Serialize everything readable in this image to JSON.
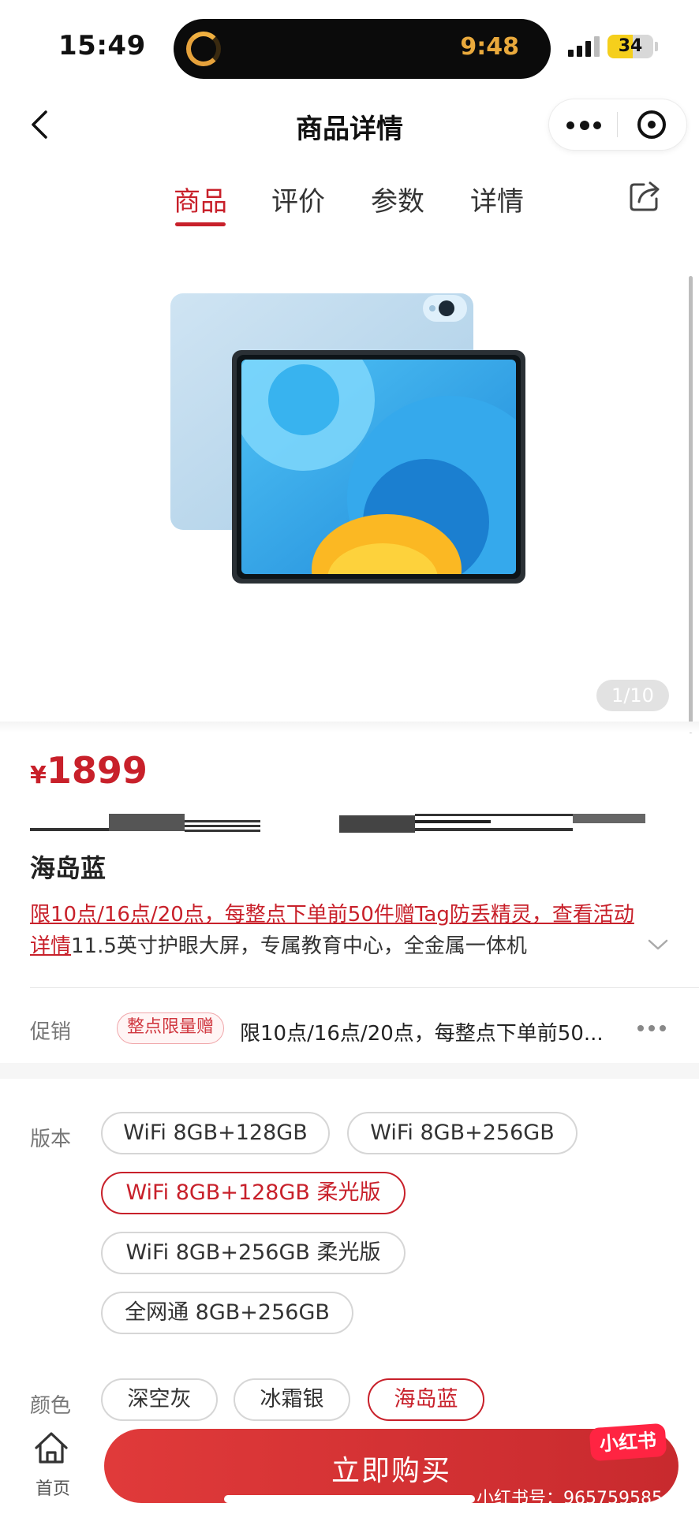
{
  "status_bar": {
    "time": "15:49",
    "island_time": "9:48",
    "battery": "34"
  },
  "nav": {
    "title": "商品详情"
  },
  "tabs": [
    {
      "label": "商品",
      "active": true
    },
    {
      "label": "评价",
      "active": false
    },
    {
      "label": "参数",
      "active": false
    },
    {
      "label": "详情",
      "active": false
    }
  ],
  "gallery": {
    "counter": "1/10"
  },
  "product": {
    "currency": "¥",
    "price": "1899",
    "color_name": "海岛蓝",
    "desc_highlight": "限10点/16点/20点，每整点下单前50件赠Tag防丢精灵，查看活动详情",
    "desc_rest": "11.5英寸护眼大屏，专属教育中心，全金属一体机"
  },
  "promo": {
    "label": "促销",
    "tag": "整点限量赠",
    "text": "限10点/16点/20点，每整点下单前50..."
  },
  "options": {
    "version_label": "版本",
    "versions": [
      {
        "label": "WiFi 8GB+128GB",
        "selected": false
      },
      {
        "label": "WiFi 8GB+256GB",
        "selected": false
      },
      {
        "label": "WiFi 8GB+128GB 柔光版",
        "selected": true
      },
      {
        "label": "WiFi 8GB+256GB 柔光版",
        "selected": false
      },
      {
        "label": "全网通 8GB+256GB",
        "selected": false
      }
    ],
    "color_label": "颜色",
    "colors": [
      {
        "label": "深空灰",
        "selected": false
      },
      {
        "label": "冰霜银",
        "selected": false
      },
      {
        "label": "海岛蓝",
        "selected": true
      }
    ]
  },
  "bottom": {
    "home_label": "首页",
    "buy_label": "立即购买",
    "watermark_logo": "小红书",
    "watermark_id": "小红书号：965759585"
  },
  "colors": {
    "accent": "#c8202a"
  }
}
